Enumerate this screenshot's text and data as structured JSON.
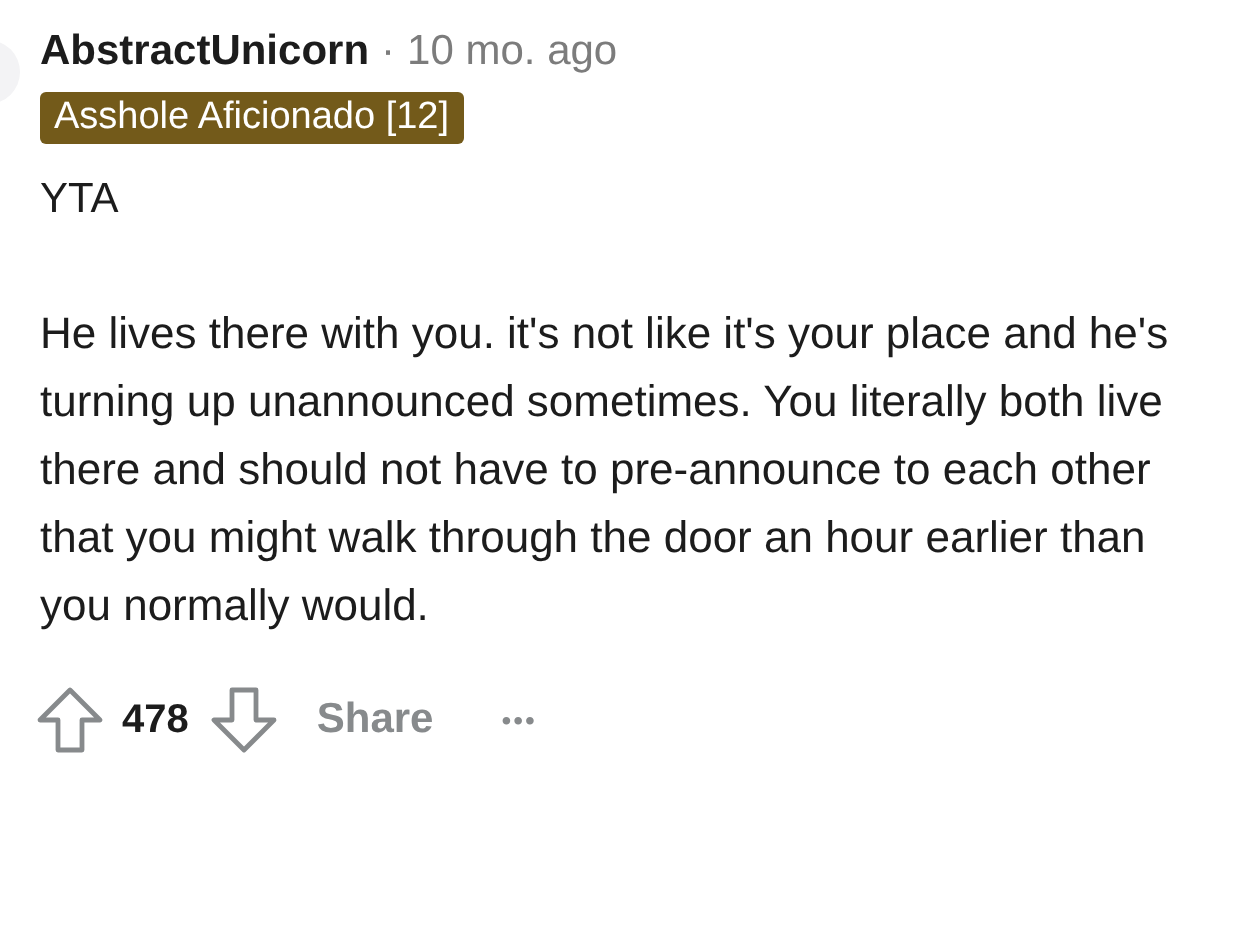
{
  "comment": {
    "author": "AbstractUnicorn",
    "separator": "·",
    "age": "10 mo. ago",
    "flair": "Asshole Aficionado [12]",
    "verdict": "YTA",
    "body": "He lives there with you. it's not like it's your place and he's turning up unannounced sometimes. You literally both live there and should not have to pre-announce to each other that you might walk through the door an hour earlier than you normally would."
  },
  "actions": {
    "score": "478",
    "share": "Share",
    "more": "•••"
  }
}
